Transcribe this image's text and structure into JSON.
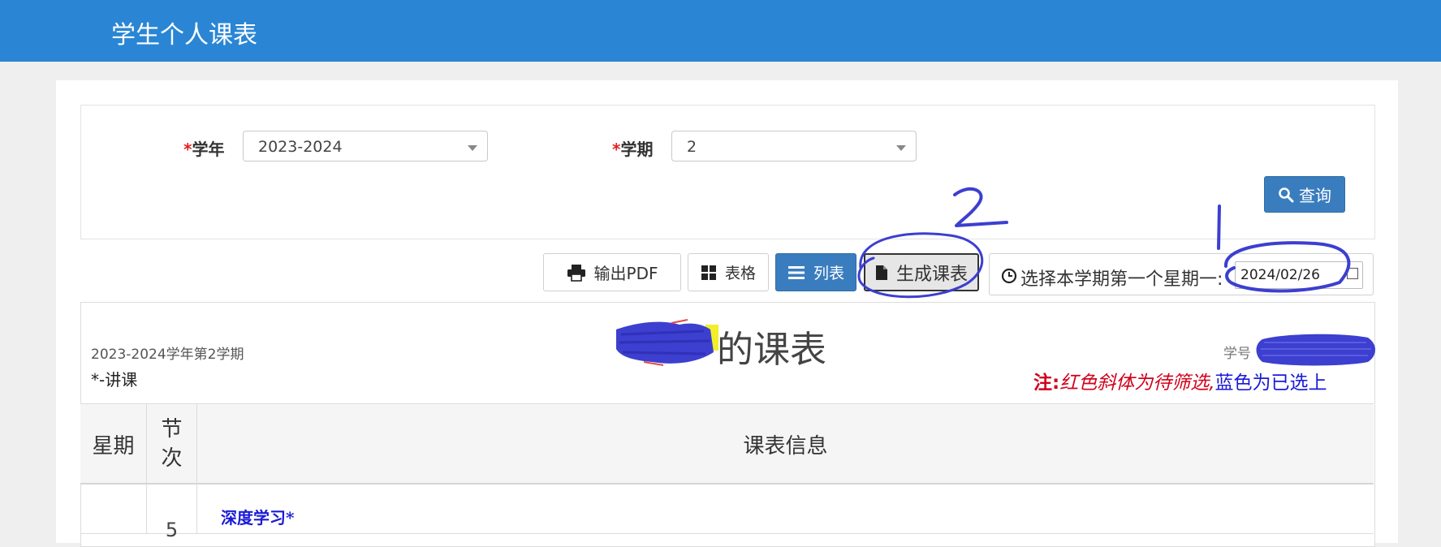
{
  "header": {
    "title": "学生个人课表"
  },
  "search": {
    "year_label_required": "*",
    "year_label": "学年",
    "year_value": "2023-2024",
    "term_label_required": "*",
    "term_label": "学期",
    "term_value": "2",
    "query_label": "查询"
  },
  "toolbar": {
    "pdf_label": "输出PDF",
    "grid_label": "表格",
    "list_label": "列表",
    "generate_label": "生成课表",
    "date_label": "选择本学期第一个星期一:",
    "date_value": "2024/02/26"
  },
  "schedule": {
    "term_text": "2023-2024学年第2学期",
    "lecture_note": "*-讲课",
    "title_suffix": "的课表",
    "student_id_label": "学号",
    "legend_prefix": "注:",
    "legend_red": "红色斜体为待筛选",
    "legend_sep": ",",
    "legend_blue": "蓝色为已选上",
    "columns": [
      "星期",
      "节次",
      "课表信息"
    ],
    "rows": [
      {
        "period": "5",
        "course": "深度学习*"
      }
    ]
  },
  "annotations": {
    "label_1": "1",
    "label_2": "2"
  },
  "colors": {
    "header": "#2a86d4",
    "primary": "#3a7dbf",
    "pen": "#3c3fcf",
    "red": "#d0021b",
    "blue": "#1a1ad8"
  }
}
